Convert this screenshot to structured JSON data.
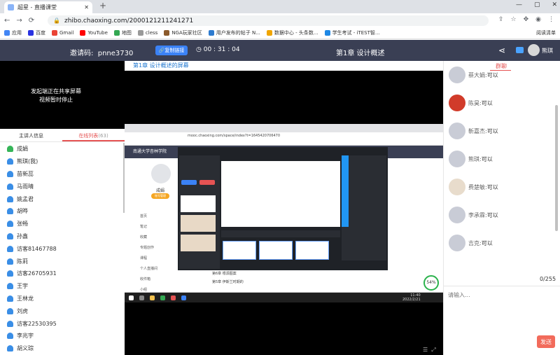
{
  "browser": {
    "tab_title": "超星 - 直播课堂",
    "new_tab": "+",
    "window_controls": [
      "—",
      "▢",
      "✕"
    ],
    "url": "zhibo.chaoxing.com/2000121211241271",
    "nav_icons": [
      "←",
      "→",
      "⟳",
      "⌂"
    ],
    "ext_icons": [
      "share-icon",
      "star-icon",
      "puzzle-icon",
      "profile-icon",
      "menu-icon"
    ],
    "bookmarks": [
      {
        "label": "应用",
        "color": "#4285f4"
      },
      {
        "label": "百度",
        "color": "#2932e1"
      },
      {
        "label": "Gmail",
        "color": "#ea4335"
      },
      {
        "label": "YouTube",
        "color": "#ff0000"
      },
      {
        "label": "地图",
        "color": "#34a853"
      },
      {
        "label": "cless",
        "color": "#999999"
      },
      {
        "label": "NGA玩家社区",
        "color": "#8b5a2b"
      },
      {
        "label": "用户发布的帖子 N...",
        "color": "#2e7bcf"
      },
      {
        "label": "数据中心 - 头条数...",
        "color": "#f0a500"
      },
      {
        "label": "学生考试 - iTEST智...",
        "color": "#1e88e5"
      }
    ],
    "reading_list": "阅读清单"
  },
  "header": {
    "invite_label": "邀请码:",
    "invite_code": "pnne3730",
    "copy_button": "复制链接",
    "timer": "00 : 31 : 04",
    "chapter_title": "第1章 设计概述",
    "user_name": "熊琪"
  },
  "video": {
    "message_line1": "发起端正在共享屏幕",
    "message_line2": "视频暂时停止"
  },
  "left_tabs": {
    "host": "主讲人信息",
    "online_label": "在线列表",
    "online_count": "(63)"
  },
  "members": [
    {
      "name": "成娟",
      "host": true
    },
    {
      "name": "熊琪(我)",
      "host": false
    },
    {
      "name": "苗新蕊",
      "host": false
    },
    {
      "name": "马雨晴",
      "host": false
    },
    {
      "name": "姚孟君",
      "host": false
    },
    {
      "name": "胡晔",
      "host": false
    },
    {
      "name": "张畅",
      "host": false
    },
    {
      "name": "孙鑫",
      "host": false
    },
    {
      "name": "访客81467788",
      "host": false
    },
    {
      "name": "陈莉",
      "host": false
    },
    {
      "name": "访客26705931",
      "host": false
    },
    {
      "name": "王宇",
      "host": false
    },
    {
      "name": "王林龙",
      "host": false
    },
    {
      "name": "刘虎",
      "host": false
    },
    {
      "name": "访客22530395",
      "host": false
    },
    {
      "name": "李兆宇",
      "host": false
    },
    {
      "name": "胡义琮",
      "host": false
    }
  ],
  "center": {
    "chapter_breadcrumb": "第1章 设计概述的屏幕",
    "inner_url": "mooc.chaoxing.com/space/index?t=1645420706470",
    "inner_site": "南通大学杏林学院",
    "inner_user": "成娟",
    "inner_badge": "账号管理",
    "inner_nav": [
      "首页",
      "笔记",
      "收藏",
      "专题创作",
      "课程",
      "个人直播间",
      "收件箱",
      "小组"
    ],
    "inner_rows": [
      "第6章 根源图案",
      "第5章 伊斯兰时期的"
    ],
    "inner_clock": "11:40",
    "inner_date": "2022/2/21",
    "gauge": "54%"
  },
  "chat": {
    "tab_label": "群聊",
    "messages": [
      {
        "name": "蔡大娟",
        "text": "可以",
        "avatar_color": "#c9ccd6"
      },
      {
        "name": "陈昊",
        "text": "可以",
        "avatar_color": "#d13b2a"
      },
      {
        "name": "靳嘉杰",
        "text": "可以",
        "avatar_color": "#c9ccd6"
      },
      {
        "name": "熊琪",
        "text": "可以",
        "avatar_color": "#c9ccd6"
      },
      {
        "name": "费楚敏",
        "text": "可以",
        "avatar_color": "#e8dccc"
      },
      {
        "name": "李承霖",
        "text": "可以",
        "avatar_color": "#c9ccd6"
      },
      {
        "name": "吉克",
        "text": "可以",
        "avatar_color": "#c9ccd6"
      }
    ],
    "counter": "0/255",
    "input_placeholder": "请输入...",
    "send_button": "发送"
  },
  "colors": {
    "topbar": "#3a3f54",
    "accent_red": "#e55353",
    "copy_blue": "#3b82f6",
    "send": "#f26b5b"
  }
}
